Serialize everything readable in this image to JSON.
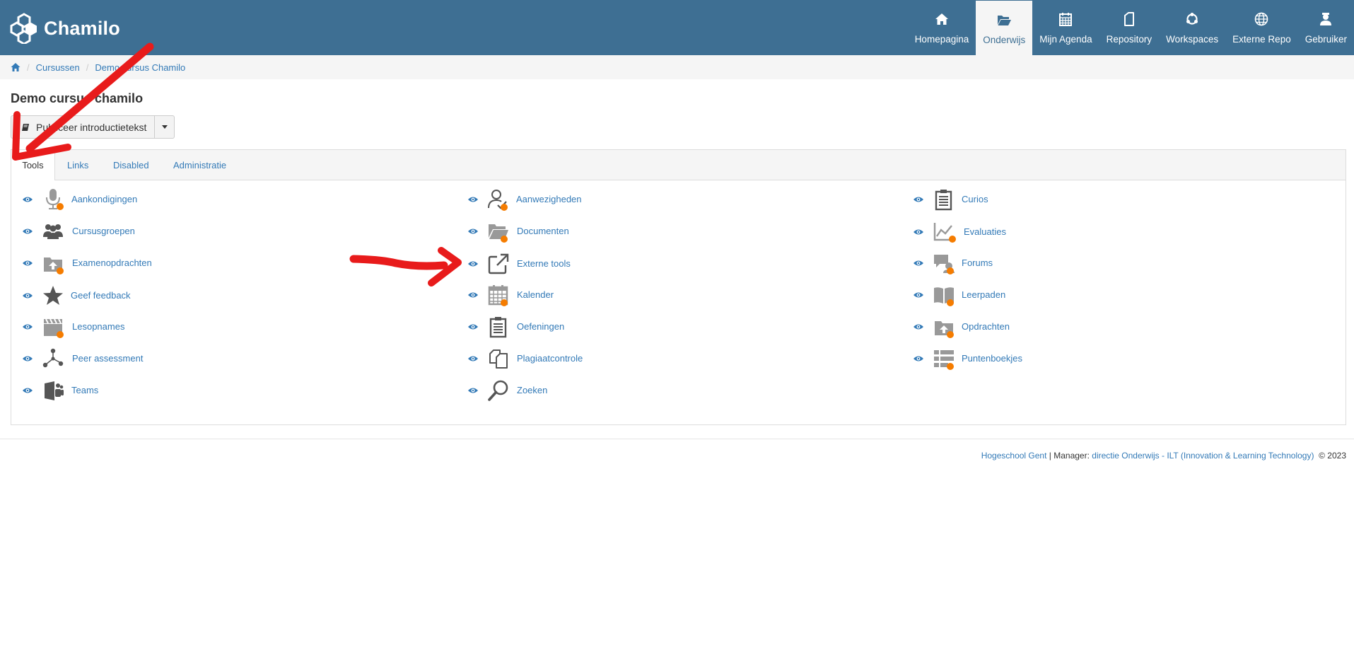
{
  "app": {
    "name": "Chamilo"
  },
  "nav": [
    {
      "label": "Homepagina",
      "icon": "home-icon"
    },
    {
      "label": "Onderwijs",
      "icon": "folder-open-icon",
      "active": true
    },
    {
      "label": "Mijn Agenda",
      "icon": "calendar-icon"
    },
    {
      "label": "Repository",
      "icon": "file-icon"
    },
    {
      "label": "Workspaces",
      "icon": "workspaces-icon"
    },
    {
      "label": "Externe Repo",
      "icon": "globe-icon"
    },
    {
      "label": "Gebruiker",
      "icon": "user-icon"
    }
  ],
  "breadcrumb": {
    "items": [
      "Cursussen",
      "Demo cursus Chamilo"
    ]
  },
  "page": {
    "title": "Demo cursus chamilo",
    "publish_button": "Publiceer introductietekst"
  },
  "tabs": [
    "Tools",
    "Links",
    "Disabled",
    "Administratie"
  ],
  "tools": {
    "col1": [
      "Aankondigingen",
      "Cursusgroepen",
      "Examenopdrachten",
      "Geef feedback",
      "Lesopnames",
      "Peer assessment",
      "Teams"
    ],
    "col2": [
      "Aanwezigheden",
      "Documenten",
      "Externe tools",
      "Kalender",
      "Oefeningen",
      "Plagiaatcontrole",
      "Zoeken"
    ],
    "col3": [
      "Curios",
      "Evaluaties",
      "Forums",
      "Leerpaden",
      "Opdrachten",
      "Puntenboekjes"
    ]
  },
  "footer": {
    "org": "Hogeschool Gent",
    "manager_label": " | Manager: ",
    "manager": "directie Onderwijs - ILT (Innovation & Learning Technology)",
    "year": "© 2023"
  },
  "colors": {
    "header": "#3e6f93",
    "link": "#337ab7",
    "badge": "#f57c00",
    "annotation": "#e81b1b"
  }
}
